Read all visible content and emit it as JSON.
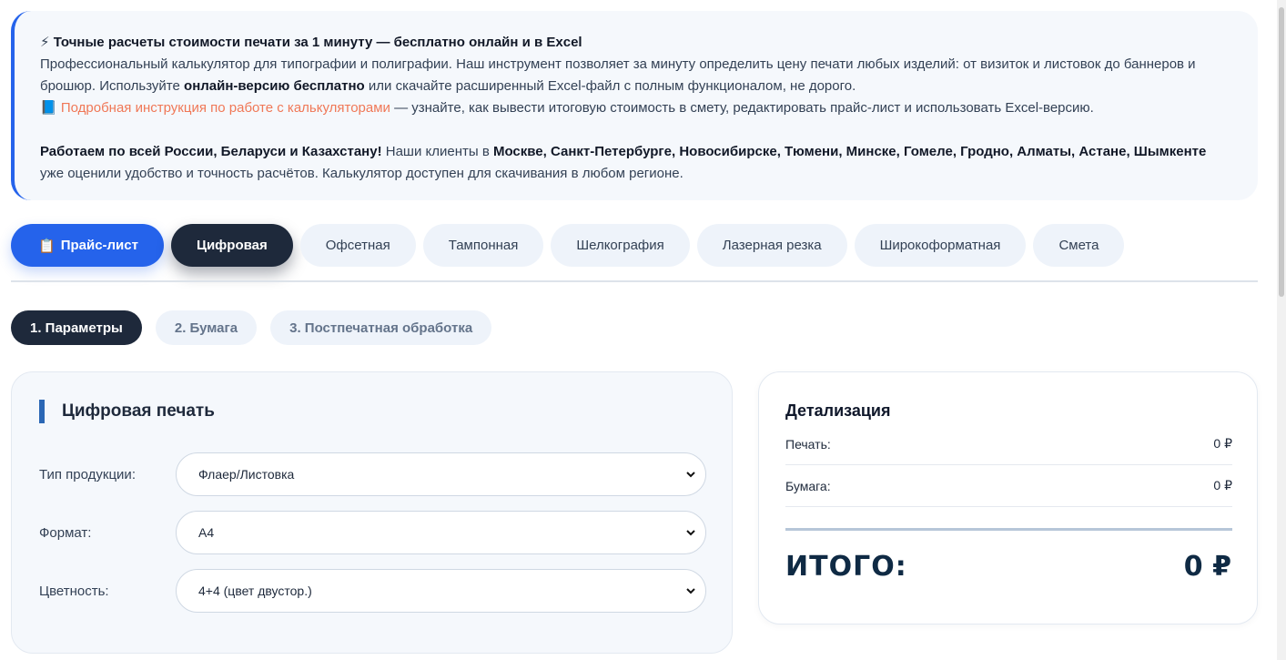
{
  "info": {
    "headline_icon": "⚡",
    "headline": "Точные расчеты стоимости печати за 1 минуту — бесплатно онлайн и в Excel",
    "p1_start": "Профессиональный калькулятор для типографии и полиграфии. Наш инструмент позволяет за минуту определить цену печати любых изделий: от визиток и листовок до баннеров и брошюр. Используйте ",
    "p1_bold": "онлайн-версию бесплатно",
    "p1_end": " или скачайте расширенный Excel-файл с полным функционалом, не дорого.",
    "book_icon": "📘",
    "link_text": "Подробная инструкция по работе с калькуляторами",
    "link_rest": " — узнайте, как вывести итоговую стоимость в смету, редактировать прайс-лист и использовать Excel-версию.",
    "p2_bold": "Работаем по всей России, Беларуси и Казахстану!",
    "p2_mid": " Наши клиенты в ",
    "p2_cities": "Москве, Санкт-Петербурге, Новосибирске, Тюмени, Минске, Гомеле, Гродно, Алматы, Астане, Шымкенте",
    "p2_end": " уже оценили удобство и точность расчётов. Калькулятор доступен для скачивания в любом регионе."
  },
  "tabs": [
    {
      "icon": "📋",
      "label": "Прайс-лист"
    },
    {
      "label": "Цифровая"
    },
    {
      "label": "Офсетная"
    },
    {
      "label": "Тампонная"
    },
    {
      "label": "Шелкография"
    },
    {
      "label": "Лазерная резка"
    },
    {
      "label": "Широкоформатная"
    },
    {
      "label": "Смета"
    }
  ],
  "steps": [
    {
      "label": "1. Параметры"
    },
    {
      "label": "2. Бумага"
    },
    {
      "label": "3. Постпечатная обработка"
    }
  ],
  "form": {
    "title": "Цифровая печать",
    "fields": [
      {
        "label": "Тип продукции:",
        "value": "Флаер/Листовка"
      },
      {
        "label": "Формат:",
        "value": "A4"
      },
      {
        "label": "Цветность:",
        "value": "4+4 (цвет двустор.)"
      }
    ]
  },
  "details": {
    "title": "Детализация",
    "rows": [
      {
        "label": "Печать:",
        "value": "0 ₽"
      },
      {
        "label": "Бумага:",
        "value": "0 ₽"
      }
    ],
    "total_label": "ИТОГО:",
    "total_value": "0 ₽"
  },
  "colors": {
    "accent": "#2563eb",
    "dark": "#1e293b",
    "link": "#f07857",
    "panel": "#f5f8fc"
  }
}
